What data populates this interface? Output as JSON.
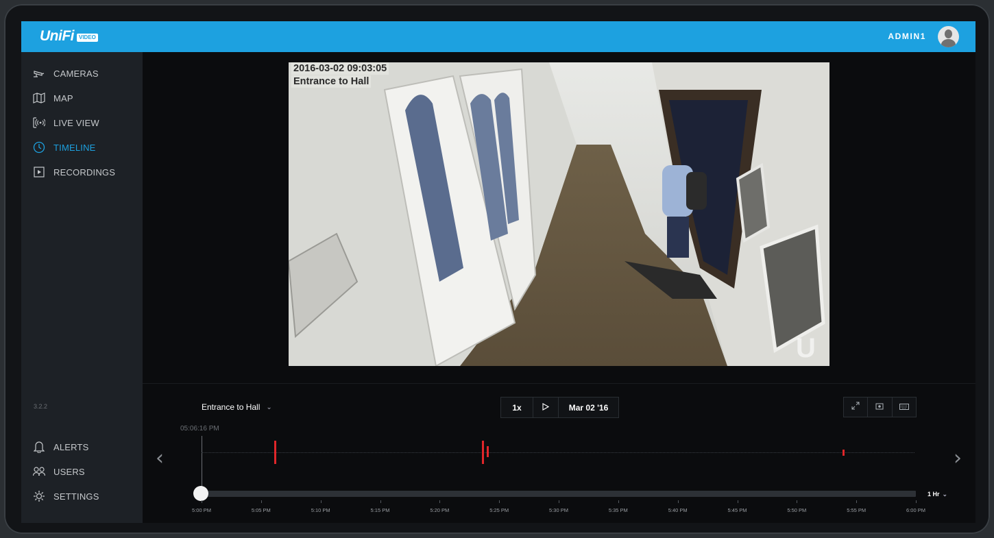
{
  "header": {
    "logo_text": "UniFi",
    "logo_badge": "VIDEO",
    "user_name": "ADMIN1"
  },
  "sidebar": {
    "items": [
      {
        "label": "CAMERAS",
        "icon": "camera-icon",
        "active": false
      },
      {
        "label": "MAP",
        "icon": "map-icon",
        "active": false
      },
      {
        "label": "LIVE VIEW",
        "icon": "live-view-icon",
        "active": false
      },
      {
        "label": "TIMELINE",
        "icon": "clock-icon",
        "active": true
      },
      {
        "label": "RECORDINGS",
        "icon": "play-box-icon",
        "active": false
      }
    ],
    "version": "3.2.2",
    "bottom_items": [
      {
        "label": "ALERTS",
        "icon": "bell-icon"
      },
      {
        "label": "USERS",
        "icon": "users-icon"
      },
      {
        "label": "SETTINGS",
        "icon": "gear-icon"
      }
    ]
  },
  "video": {
    "timestamp": "2016-03-02 09:03:05",
    "camera_name": "Entrance to Hall"
  },
  "controls": {
    "camera_select": "Entrance to Hall",
    "speed": "1x",
    "date": "Mar 02 '16",
    "cursor_time": "05:06:16 PM",
    "zoom": "1 Hr"
  },
  "timeline": {
    "ticks": [
      "5:00 PM",
      "5:05 PM",
      "5:10 PM",
      "5:15 PM",
      "5:20 PM",
      "5:25 PM",
      "5:30 PM",
      "5:35 PM",
      "5:40 PM",
      "5:45 PM",
      "5:50 PM",
      "5:55 PM",
      "6:00 PM"
    ],
    "event_color": "#e0262a",
    "accent_color": "#1da1e0"
  }
}
